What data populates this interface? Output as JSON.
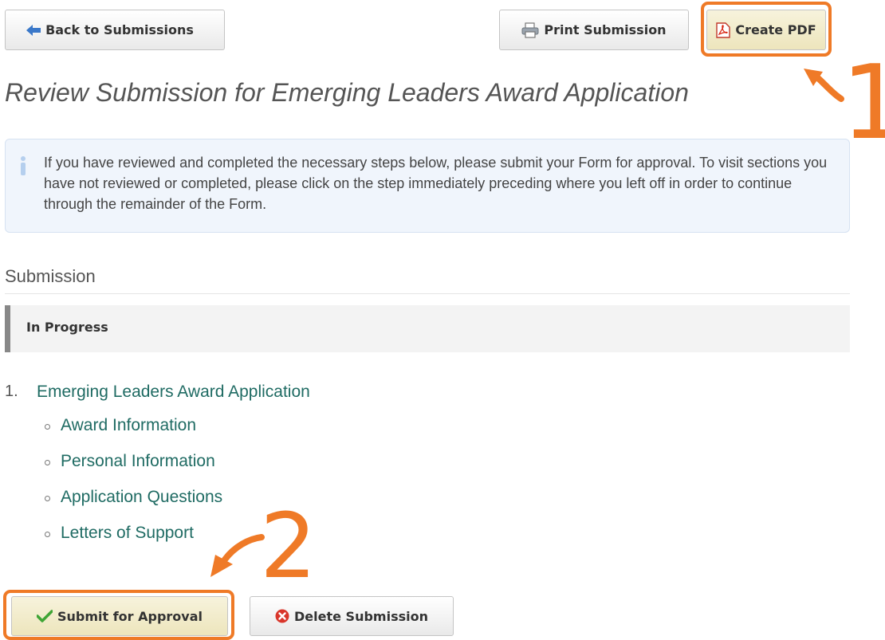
{
  "toolbar": {
    "back_label": "Back to Submissions",
    "print_label": "Print Submission",
    "pdf_label": "Create PDF"
  },
  "page": {
    "title": "Review Submission for Emerging Leaders Award Application"
  },
  "info": {
    "message": "If you have reviewed and completed the necessary steps below, please submit your Form for approval. To visit sections you have not reviewed or completed, please click on the step immediately preceding where you left off in order to continue through the remainder of the Form."
  },
  "submission": {
    "section_title": "Submission",
    "status": "In Progress",
    "steps": [
      {
        "number": "1.",
        "label": "Emerging Leaders Award Application",
        "sections": [
          "Award Information",
          "Personal Information",
          "Application Questions",
          "Letters of Support"
        ]
      }
    ]
  },
  "actions": {
    "submit_label": "Submit for Approval",
    "delete_label": "Delete Submission"
  },
  "annotations": {
    "marker_1": "1",
    "marker_2": "2"
  },
  "colors": {
    "highlight": "#ef7a27",
    "link": "#1f6b63",
    "info_background": "#f0f5fc",
    "primary_button": "#ede5bc"
  }
}
